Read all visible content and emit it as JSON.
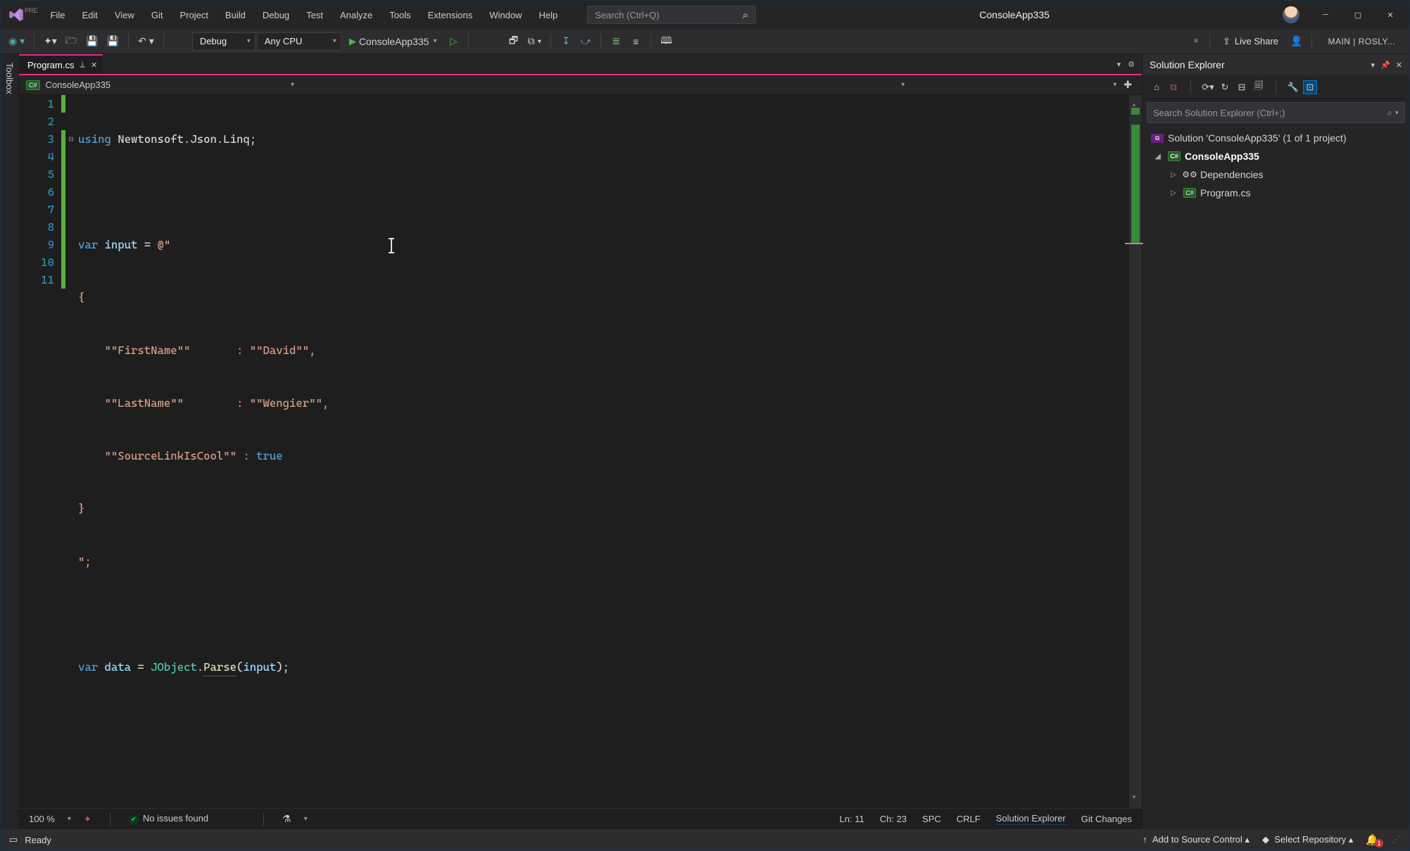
{
  "menu": [
    "File",
    "Edit",
    "View",
    "Git",
    "Project",
    "Build",
    "Debug",
    "Test",
    "Analyze",
    "Tools",
    "Extensions",
    "Window",
    "Help"
  ],
  "titleSearch": "Search (Ctrl+Q)",
  "appTitle": "ConsoleApp335",
  "toolbar": {
    "config": "Debug",
    "platform": "Any CPU",
    "startTarget": "ConsoleApp335",
    "liveShare": "Live Share",
    "branch": "MAIN | ROSLY..."
  },
  "toolboxLabel": "Toolbox",
  "tab": {
    "name": "Program.cs"
  },
  "breadcrumb": {
    "project": "ConsoleApp335"
  },
  "code": {
    "lines": [
      1,
      2,
      3,
      4,
      5,
      6,
      7,
      8,
      9,
      10,
      11
    ],
    "l1_using": "using",
    "l1_ns1": "Newtonsoft",
    "l1_ns2": "Json",
    "l1_ns3": "Linq",
    "l3_var": "var",
    "l3_name": "input",
    "l3_eq": " = ",
    "l3_at": "@\"",
    "l4": "{",
    "l5_key": "\"\"FirstName\"\"",
    "l5_colon": "       : ",
    "l5_val": "\"\"David\"\"",
    "l5_comma": ",",
    "l6_key": "\"\"LastName\"\"",
    "l6_colon": "        : ",
    "l6_val": "\"\"Wengier\"\"",
    "l6_comma": ",",
    "l7_key": "\"\"SourceLinkIsCool\"\"",
    "l7_colon": " : ",
    "l7_val": "true",
    "l8": "}",
    "l9": "\";",
    "l11_var": "var",
    "l11_name": "data",
    "l11_eq": " = ",
    "l11_type": "JObject",
    "l11_method": "Parse",
    "l11_arg": "input"
  },
  "solExp": {
    "title": "Solution Explorer",
    "search": "Search Solution Explorer (Ctrl+;)",
    "solution": "Solution 'ConsoleApp335' (1 of 1 project)",
    "project": "ConsoleApp335",
    "deps": "Dependencies",
    "file": "Program.cs"
  },
  "editorStatus": {
    "zoom": "100 %",
    "issues": "No issues found",
    "ln": "Ln: 11",
    "ch": "Ch: 23",
    "spc": "SPC",
    "crlf": "CRLF",
    "link1": "Solution Explorer",
    "link2": "Git Changes"
  },
  "statusbar": {
    "ready": "Ready",
    "addSc": "Add to Source Control",
    "repo": "Select Repository",
    "notif": "1"
  }
}
